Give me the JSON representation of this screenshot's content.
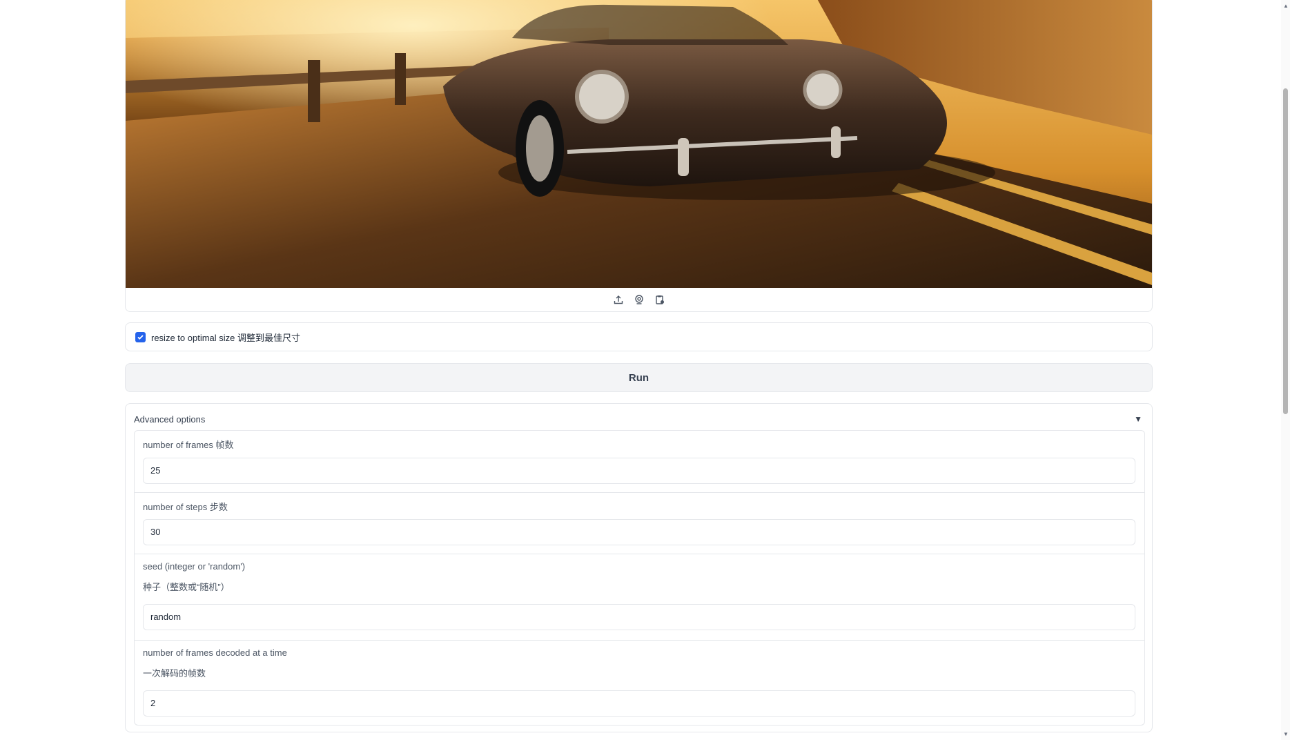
{
  "image_panel": {
    "image_alt": "vintage convertible sports car driving along coastal road at sunset",
    "source_icons": [
      "upload-icon",
      "webcam-icon",
      "clipboard-icon"
    ]
  },
  "resize_checkbox": {
    "checked": true,
    "label": "resize to optimal size 调整到最佳尺寸"
  },
  "run_button": {
    "label": "Run"
  },
  "advanced": {
    "title": "Advanced options",
    "expanded": true,
    "fields": [
      {
        "label": "number of frames 帧数",
        "value": "25"
      },
      {
        "label": "number of steps 步数",
        "value": "30"
      },
      {
        "label": "seed (integer or 'random')",
        "label_line2": "种子（整数或“随机”）",
        "value": "random"
      },
      {
        "label": "number of frames decoded at a time",
        "label_line2": "一次解码的帧数",
        "value": "2"
      }
    ]
  },
  "colors": {
    "accent": "#2563eb",
    "border": "#e5e7eb",
    "button_bg": "#f3f4f6"
  }
}
